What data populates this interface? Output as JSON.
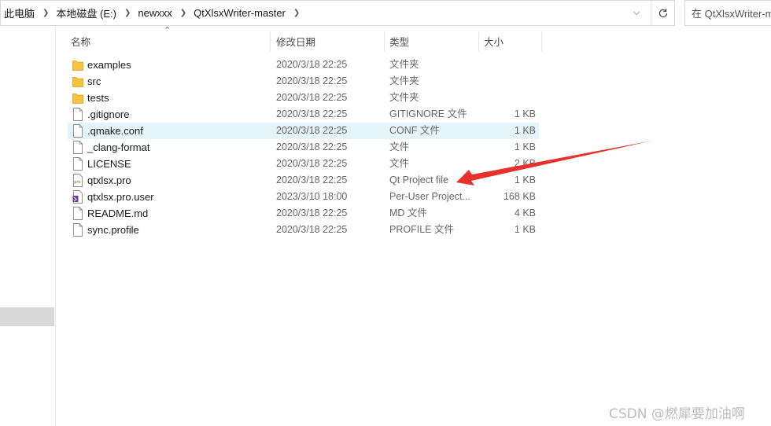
{
  "breadcrumb": [
    "此电脑",
    "本地磁盘 (E:)",
    "newxxx",
    "QtXlsxWriter-master"
  ],
  "search": {
    "placeholder": "在 QtXlsxWriter-master 中搜索"
  },
  "columns": {
    "name": "名称",
    "modified": "修改日期",
    "type": "类型",
    "size": "大小"
  },
  "files": [
    {
      "name": "examples",
      "modified": "2020/3/18 22:25",
      "type": "文件夹",
      "size": "",
      "icon": "folder-icon"
    },
    {
      "name": "src",
      "modified": "2020/3/18 22:25",
      "type": "文件夹",
      "size": "",
      "icon": "folder-icon"
    },
    {
      "name": "tests",
      "modified": "2020/3/18 22:25",
      "type": "文件夹",
      "size": "",
      "icon": "folder-icon"
    },
    {
      "name": ".gitignore",
      "modified": "2020/3/18 22:25",
      "type": "GITIGNORE 文件",
      "size": "1 KB",
      "icon": "file-icon"
    },
    {
      "name": ".qmake.conf",
      "modified": "2020/3/18 22:25",
      "type": "CONF 文件",
      "size": "1 KB",
      "icon": "file-icon"
    },
    {
      "name": "_clang-format",
      "modified": "2020/3/18 22:25",
      "type": "文件",
      "size": "1 KB",
      "icon": "file-icon"
    },
    {
      "name": "LICENSE",
      "modified": "2020/3/18 22:25",
      "type": "文件",
      "size": "2 KB",
      "icon": "file-icon"
    },
    {
      "name": "qtxlsx.pro",
      "modified": "2020/3/18 22:25",
      "type": "Qt Project file",
      "size": "1 KB",
      "icon": "qt-project-icon"
    },
    {
      "name": "qtxlsx.pro.user",
      "modified": "2023/3/10 18:00",
      "type": "Per-User Project...",
      "size": "168 KB",
      "icon": "visual-studio-file-icon"
    },
    {
      "name": "README.md",
      "modified": "2020/3/18 22:25",
      "type": "MD 文件",
      "size": "4 KB",
      "icon": "file-icon"
    },
    {
      "name": "sync.profile",
      "modified": "2020/3/18 22:25",
      "type": "PROFILE 文件",
      "size": "1 KB",
      "icon": "file-icon"
    }
  ],
  "selected_index": 4,
  "watermark": "CSDN @燃犀要加油啊",
  "colors": {
    "selection": "#e5f3fb",
    "folder": "#f5c342",
    "arrow": "#e8312c"
  }
}
